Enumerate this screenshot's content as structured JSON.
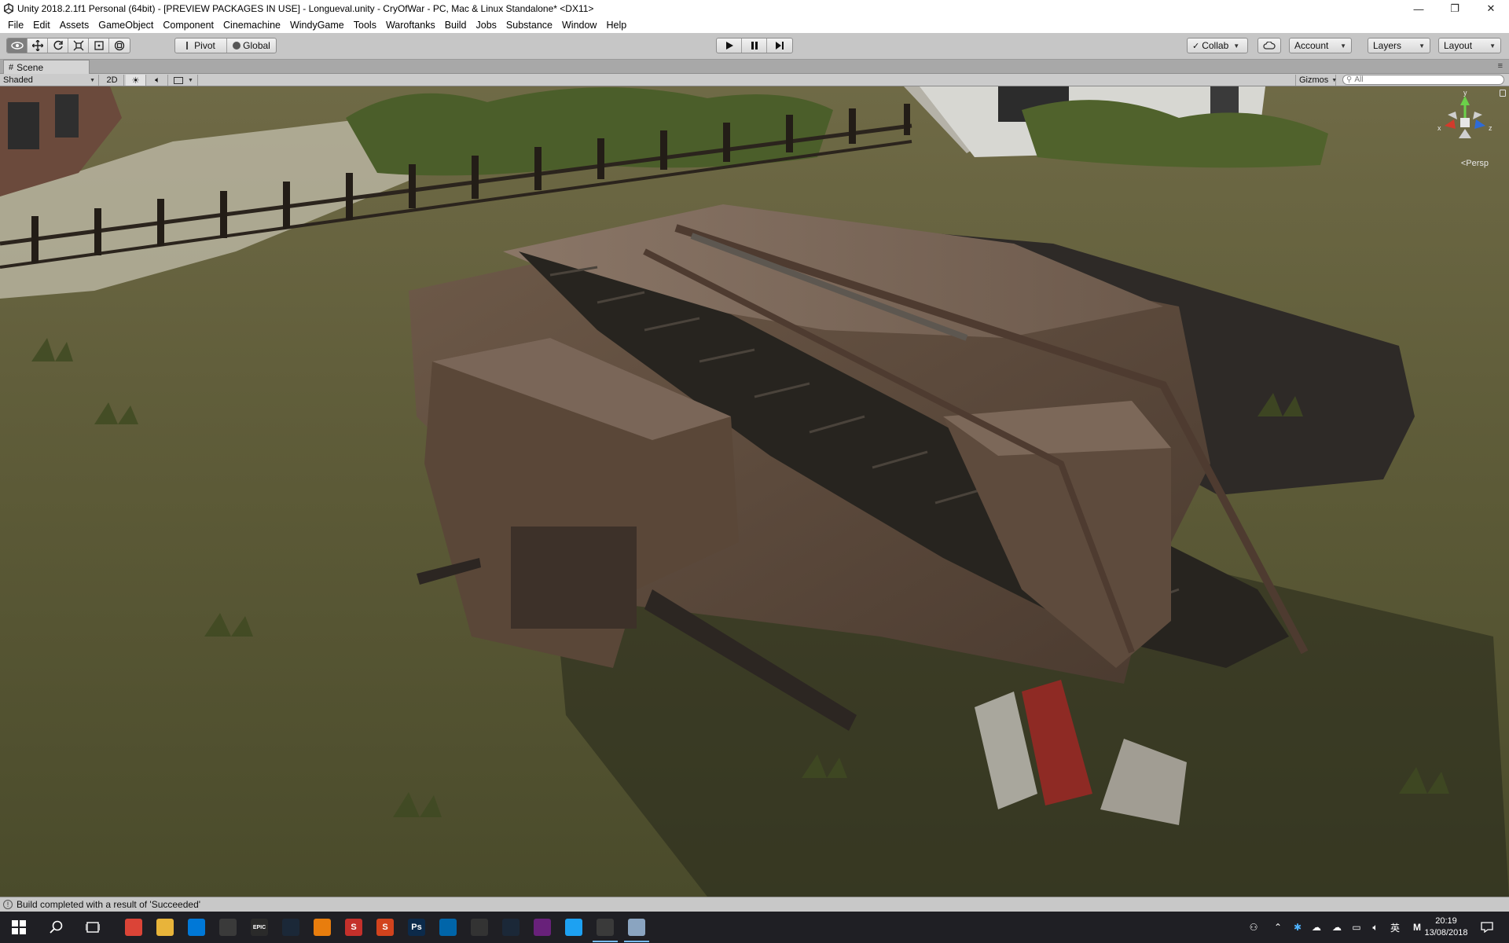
{
  "window": {
    "title": "Unity 2018.2.1f1 Personal (64bit) - [PREVIEW PACKAGES IN USE] - Longueval.unity - CryOfWar - PC, Mac & Linux Standalone* <DX11>",
    "minimize": "—",
    "maximize": "❐",
    "close": "✕"
  },
  "menu": [
    "File",
    "Edit",
    "Assets",
    "GameObject",
    "Component",
    "Cinemachine",
    "WindyGame",
    "Tools",
    "Waroftanks",
    "Build",
    "Jobs",
    "Substance",
    "Window",
    "Help"
  ],
  "toolbar": {
    "pivot": "Pivot",
    "global": "Global",
    "collab": "Collab",
    "account": "Account",
    "layers": "Layers",
    "layout": "Layout"
  },
  "scene_tab": {
    "label": "Scene"
  },
  "scene_bar": {
    "shading": "Shaded",
    "mode_2d": "2D",
    "gizmos": "Gizmos",
    "search_placeholder": "All"
  },
  "viewport": {
    "projection": "Persp",
    "axis_labels": {
      "x": "x",
      "y": "y",
      "z": "z"
    }
  },
  "status": {
    "message": "Build completed with a result of 'Succeeded'"
  },
  "taskbar": {
    "time": "20:19",
    "date": "13/08/2018",
    "ime": "英",
    "apps": [
      {
        "name": "chrome-icon",
        "color": "#db4437",
        "text": ""
      },
      {
        "name": "file-explorer-icon",
        "color": "#e8b43a",
        "text": ""
      },
      {
        "name": "store-icon",
        "color": "#0078d7",
        "text": ""
      },
      {
        "name": "mail-icon",
        "color": "#3a3a3a",
        "text": ""
      },
      {
        "name": "epic-games-icon",
        "color": "#2a2a2a",
        "text": "EPIC"
      },
      {
        "name": "steam-icon",
        "color": "#1b2838",
        "text": ""
      },
      {
        "name": "blender-icon",
        "color": "#e87d0d",
        "text": ""
      },
      {
        "name": "substance-icon",
        "color": "#c4302b",
        "text": "S"
      },
      {
        "name": "substance-designer-icon",
        "color": "#d2431d",
        "text": "S"
      },
      {
        "name": "photoshop-icon",
        "color": "#0c2a4a",
        "text": "Ps"
      },
      {
        "name": "vscode-icon",
        "color": "#0065a9",
        "text": ""
      },
      {
        "name": "unity-hub-icon",
        "color": "#333333",
        "text": ""
      },
      {
        "name": "steam-alt-icon",
        "color": "#1b2838",
        "text": ""
      },
      {
        "name": "visual-studio-icon",
        "color": "#68217a",
        "text": ""
      },
      {
        "name": "support-icon",
        "color": "#1da1f2",
        "text": ""
      },
      {
        "name": "unity-icon",
        "color": "#3a3a3a",
        "text": ""
      },
      {
        "name": "image-viewer-icon",
        "color": "#8aa4c0",
        "text": ""
      }
    ]
  }
}
